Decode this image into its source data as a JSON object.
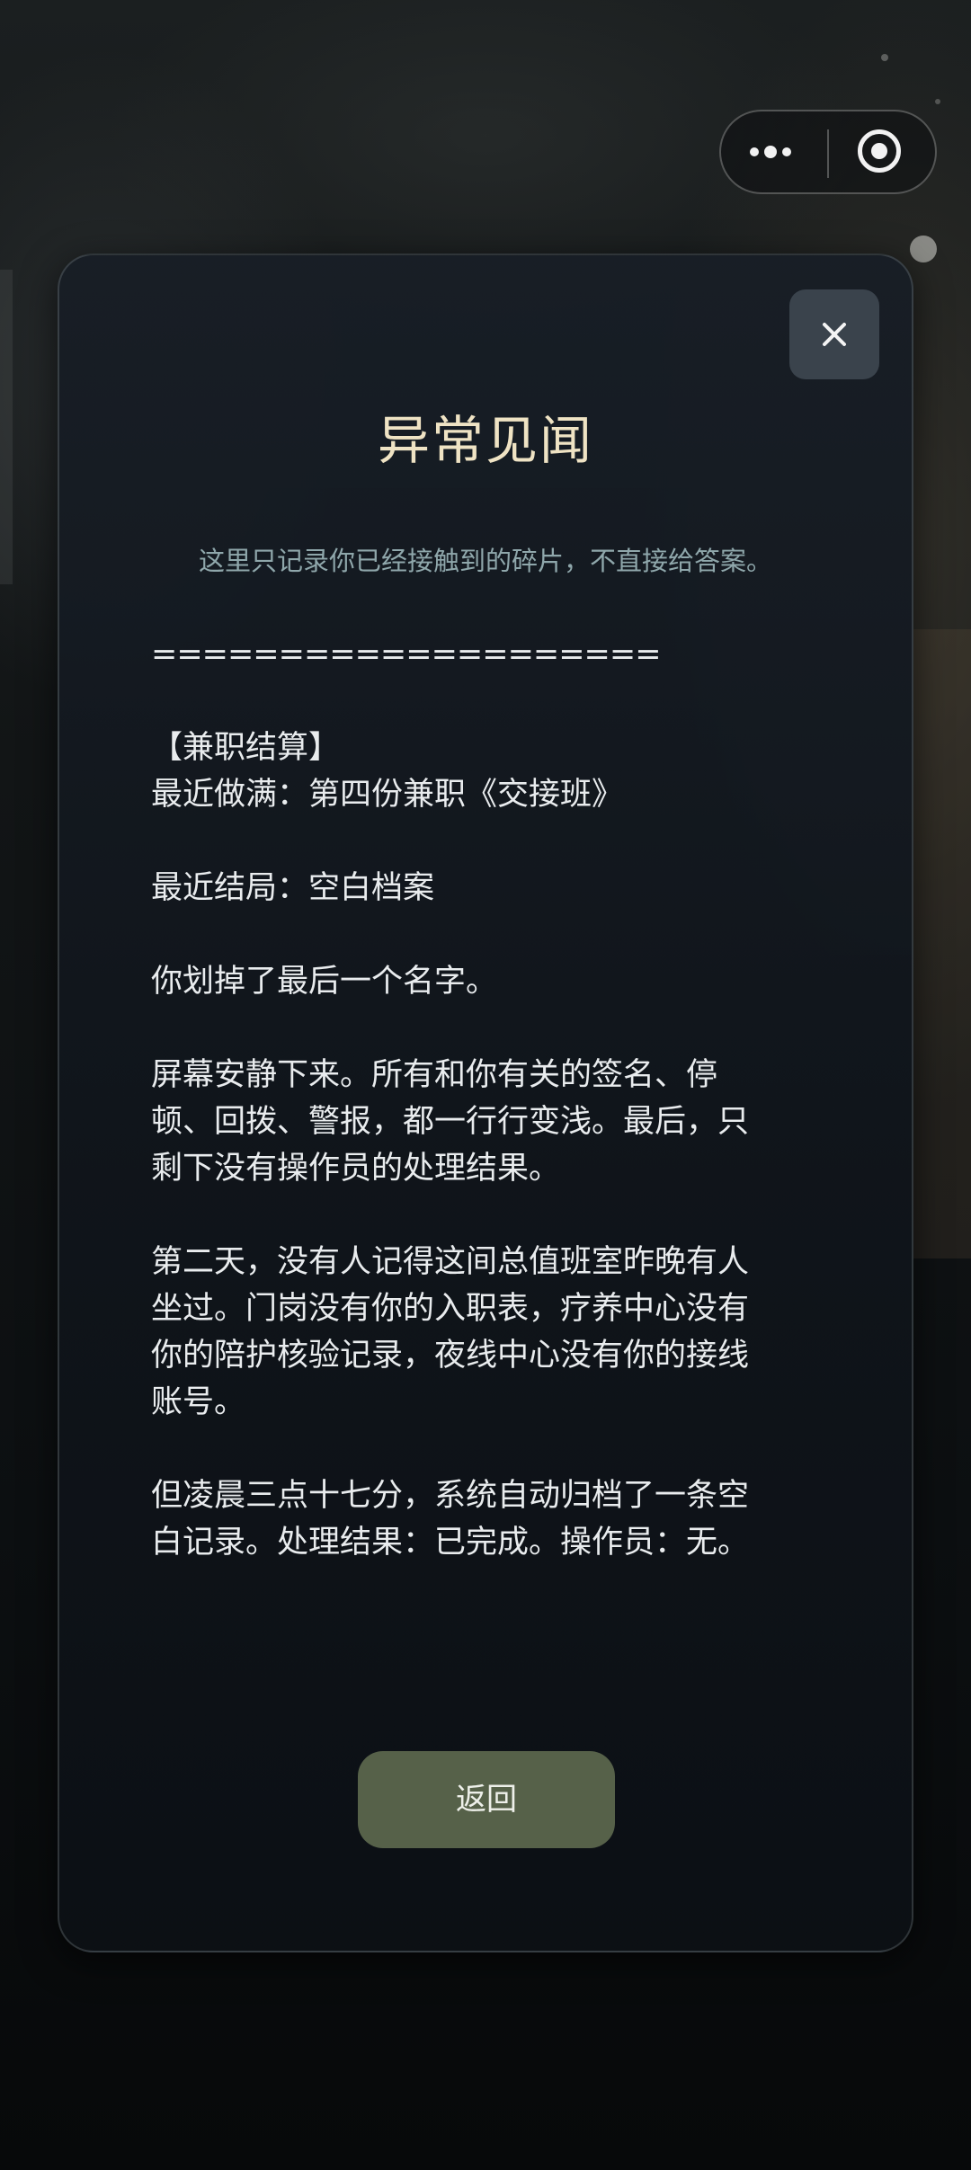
{
  "modal": {
    "title": "异常见闻",
    "subtitle": "这里只记录你已经接触到的碎片，不直接给答案。",
    "content_lines": [
      "====================",
      "",
      "【兼职结算】",
      "最近做满：第四份兼职《交接班》",
      "",
      "最近结局：空白档案",
      "",
      "你划掉了最后一个名字。",
      "",
      "屏幕安静下来。所有和你有关的签名、停",
      "顿、回拨、警报，都一行行变浅。最后，只",
      "剩下没有操作员的处理结果。",
      "",
      "第二天，没有人记得这间总值班室昨晚有人",
      "坐过。门岗没有你的入职表，疗养中心没有",
      "你的陪护核验记录，夜线中心没有你的接线",
      "账号。",
      "",
      "但凌晨三点十七分，系统自动归档了一条空",
      "白记录。处理结果：已完成。操作员：无。"
    ],
    "back_label": "返回",
    "close_icon": "close-icon"
  },
  "capsule": {
    "more_icon": "more-dots-icon",
    "exit_icon": "target-circle-icon"
  }
}
